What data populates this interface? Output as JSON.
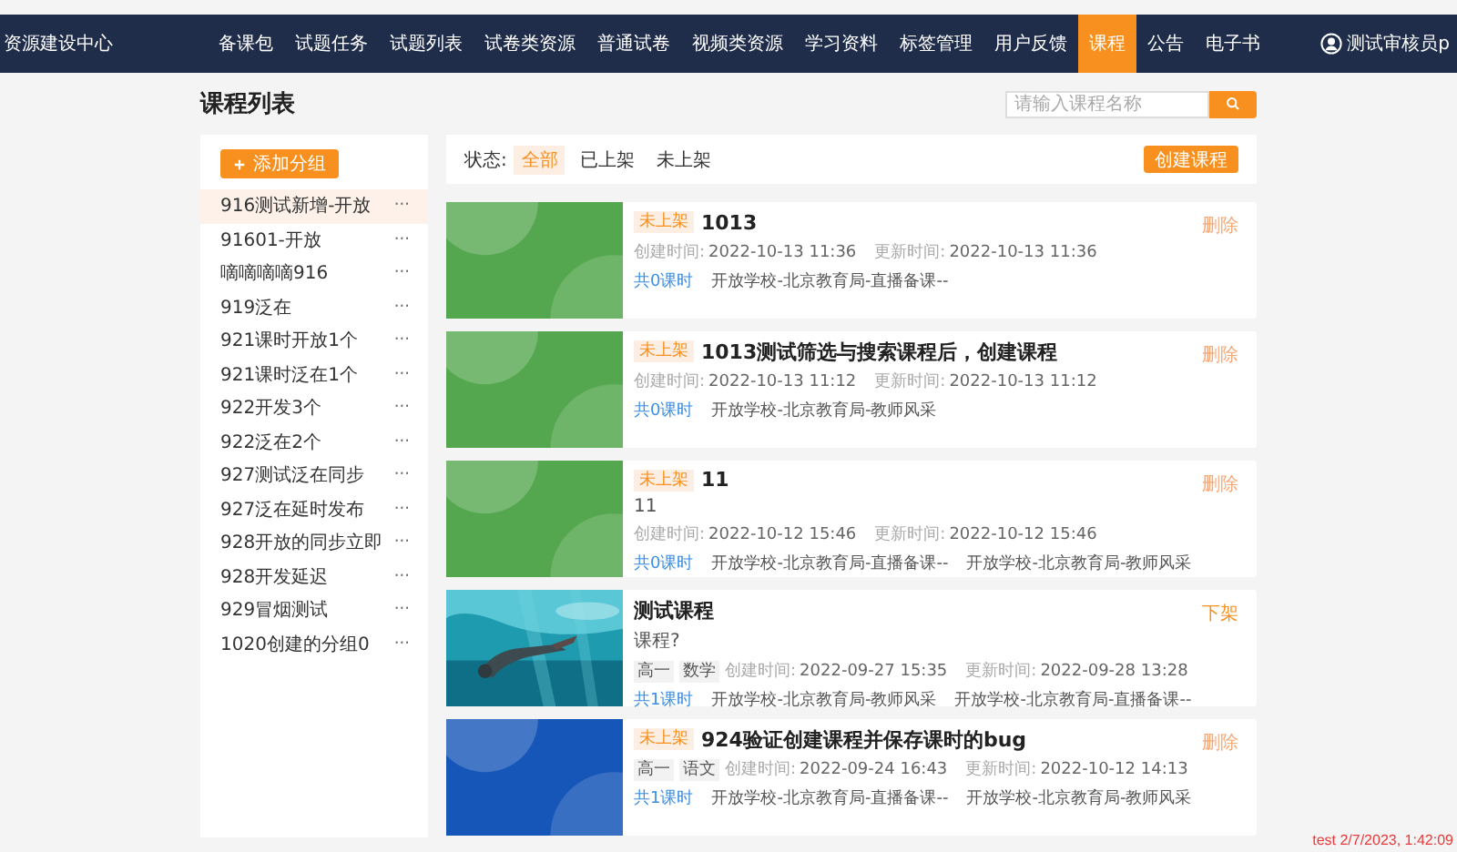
{
  "nav": {
    "brand": "资源建设中心",
    "items": [
      {
        "label": "备课包",
        "selected": false
      },
      {
        "label": "试题任务",
        "selected": false
      },
      {
        "label": "试题列表",
        "selected": false
      },
      {
        "label": "试卷类资源",
        "selected": false
      },
      {
        "label": "普通试卷",
        "selected": false
      },
      {
        "label": "视频类资源",
        "selected": false
      },
      {
        "label": "学习资料",
        "selected": false
      },
      {
        "label": "标签管理",
        "selected": false
      },
      {
        "label": "用户反馈",
        "selected": false
      },
      {
        "label": "课程",
        "selected": true
      },
      {
        "label": "公告",
        "selected": false
      },
      {
        "label": "电子书",
        "selected": false
      }
    ],
    "user": "测试审核员p"
  },
  "page_title": "课程列表",
  "search": {
    "placeholder": "请输入课程名称"
  },
  "sidebar": {
    "add_button": "添加分组",
    "groups": [
      {
        "label": "916测试新增-开放",
        "selected": true,
        "more": "···"
      },
      {
        "label": "91601-开放",
        "selected": false,
        "more": "···"
      },
      {
        "label": "嘀嘀嘀嘀916",
        "selected": false,
        "more": "···"
      },
      {
        "label": "919泛在",
        "selected": false,
        "more": "···"
      },
      {
        "label": "921课时开放1个",
        "selected": false,
        "more": "···"
      },
      {
        "label": "921课时泛在1个",
        "selected": false,
        "more": "···"
      },
      {
        "label": "922开发3个",
        "selected": false,
        "more": "···"
      },
      {
        "label": "922泛在2个",
        "selected": false,
        "more": "···"
      },
      {
        "label": "927测试泛在同步",
        "selected": false,
        "more": "···"
      },
      {
        "label": "927泛在延时发布",
        "selected": false,
        "more": "···"
      },
      {
        "label": "928开放的同步立即",
        "selected": false,
        "more": "···"
      },
      {
        "label": "928开发延迟",
        "selected": false,
        "more": "···"
      },
      {
        "label": "929冒烟测试",
        "selected": false,
        "more": "···"
      },
      {
        "label": "1020创建的分组0",
        "selected": false,
        "more": "···"
      }
    ]
  },
  "filter": {
    "label": "状态:",
    "options": [
      {
        "label": "全部",
        "selected": true
      },
      {
        "label": "已上架",
        "selected": false
      },
      {
        "label": "未上架",
        "selected": false
      }
    ],
    "create_button": "创建课程"
  },
  "courses": [
    {
      "cover": {
        "kind": "generated",
        "color": "#55a74f"
      },
      "status": "未上架",
      "title": "1013",
      "created_label": "创建时间:",
      "created": "2022-10-13 11:36",
      "updated_label": "更新时间:",
      "updated": "2022-10-13 11:36",
      "lessons": "共0课时",
      "categories": [
        "开放学校-北京教育局-直播备课--"
      ],
      "action": "删除",
      "kind": "delete"
    },
    {
      "cover": {
        "kind": "generated",
        "color": "#55a74f"
      },
      "status": "未上架",
      "title": "1013测试筛选与搜索课程后，创建课程",
      "created_label": "创建时间:",
      "created": "2022-10-13 11:12",
      "updated_label": "更新时间:",
      "updated": "2022-10-13 11:12",
      "lessons": "共0课时",
      "categories": [
        "开放学校-北京教育局-教师风采"
      ],
      "action": "删除",
      "kind": "delete"
    },
    {
      "cover": {
        "kind": "generated",
        "color": "#55a74f"
      },
      "status": "未上架",
      "title": "11",
      "subtitle": "11",
      "created_label": "创建时间:",
      "created": "2022-10-12 15:46",
      "updated_label": "更新时间:",
      "updated": "2022-10-12 15:46",
      "lessons": "共0课时",
      "categories": [
        "开放学校-北京教育局-直播备课--",
        "开放学校-北京教育局-教师风采"
      ],
      "action": "删除",
      "kind": "delete"
    },
    {
      "cover": {
        "kind": "picture"
      },
      "title": "测试课程",
      "subtitle": "课程?",
      "tags": [
        "高一",
        "数学"
      ],
      "created_label": "创建时间:",
      "created": "2022-09-27 15:35",
      "updated_label": "更新时间:",
      "updated": "2022-09-28 13:28",
      "lessons": "共1课时",
      "categories": [
        "开放学校-北京教育局-教师风采",
        "开放学校-北京教育局-直播备课--"
      ],
      "action": "下架",
      "kind": "unpublish"
    },
    {
      "cover": {
        "kind": "generated",
        "color": "#1656b8"
      },
      "status": "未上架",
      "title": "924验证创建课程并保存课时的bug",
      "tags": [
        "高一",
        "语文"
      ],
      "created_label": "创建时间:",
      "created": "2022-09-24 16:43",
      "updated_label": "更新时间:",
      "updated": "2022-10-12 14:13",
      "lessons": "共1课时",
      "categories": [
        "开放学校-北京教育局-直播备课--",
        "开放学校-北京教育局-教师风采"
      ],
      "action": "删除",
      "kind": "delete"
    }
  ],
  "stamp": "test 2/7/2023, 1:42:09"
}
